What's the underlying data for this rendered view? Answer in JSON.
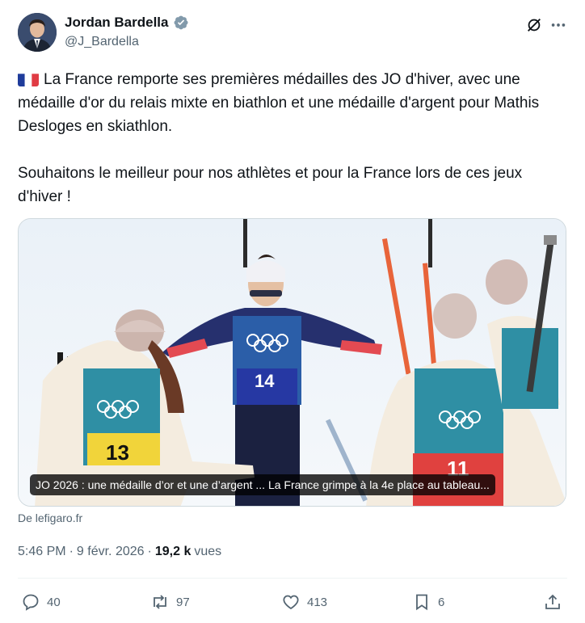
{
  "author": {
    "display_name": "Jordan Bardella",
    "handle": "@J_Bardella",
    "verified_icon": "verified-badge-icon"
  },
  "tweet": {
    "paragraph1": "La France remporte ses premières médailles des JO d'hiver, avec une médaille d'or du relais mixte en biathlon et une médaille d'argent pour Mathis Desloges en skiathlon.",
    "paragraph2": "Souhaitons le meilleur pour nos athlètes et pour la France lors de ces jeux d'hiver !"
  },
  "card": {
    "caption": "JO 2026 : une médaille d’or et une d’argent ... La France grimpe à la 4e place au tableau...",
    "source": "De lefigaro.fr",
    "bib_left": "13",
    "bib_center": "14",
    "bib_right": "11"
  },
  "meta": {
    "time": "5:46 PM",
    "sep1": "·",
    "date": "9 févr. 2026",
    "sep2": "·",
    "views_count": "19,2 k",
    "views_label": "vues"
  },
  "actions": {
    "replies": "40",
    "reposts": "97",
    "likes": "413",
    "bookmarks": "6"
  },
  "colors": {
    "accent": "#1d9bf0",
    "muted_text": "#536471",
    "main_text": "#0f1419",
    "border": "#cfd9de"
  }
}
